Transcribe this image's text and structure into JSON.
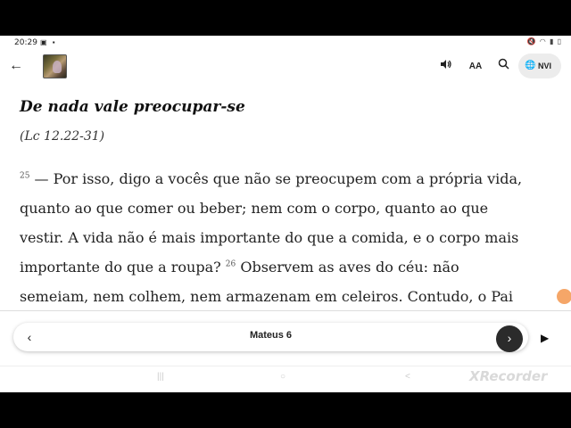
{
  "status": {
    "time": "20:29",
    "left_icons": "▣ ▪",
    "right_icons": "🔇 ◠ ▮ ▯"
  },
  "toolbar": {
    "back_icon": "arrow-left-icon",
    "font_label": "AA",
    "version_label": "NVI"
  },
  "passage": {
    "heading": "De nada vale preocupar-se",
    "reference": "(Lc 12.22-31)",
    "verse25_number": "25",
    "line1": "— Por isso, digo a vocês que não se preocupem com a própria vida,",
    "line2": "quanto ao que comer ou beber; nem com o corpo, quanto ao que",
    "line3": "vestir. A vida não é mais importante do que a comida, e o corpo mais",
    "line4a": "importante do que a roupa?",
    "verse26_number": "26",
    "line4b": "Observem as aves do céu: não",
    "line5": "semeiam, nem colhem, nem armazenam em celeiros. Contudo, o Pai"
  },
  "chapter_nav": {
    "title": "Mateus 6"
  },
  "watermark": "XRecorder"
}
